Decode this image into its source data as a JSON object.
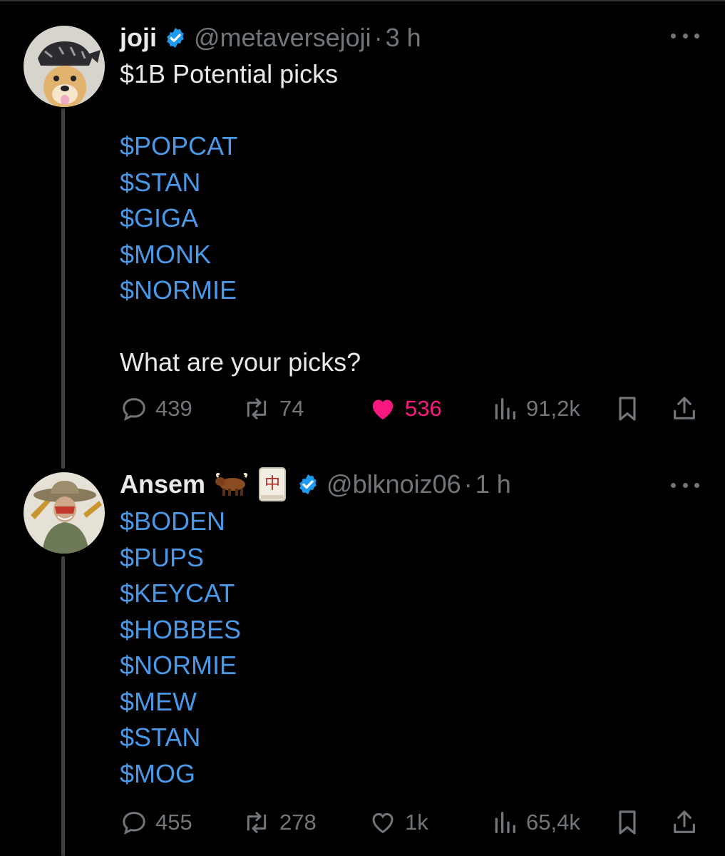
{
  "tweets": [
    {
      "name": "joji",
      "handle": "@metaversejoji",
      "time_separator": "·",
      "time": "3 h",
      "lines": [
        "$1B Potential picks",
        "",
        "$POPCAT",
        "$STAN",
        "$GIGA",
        "$MONK",
        "$NORMIE",
        "",
        "What are your picks?"
      ],
      "cashtag_lines": [
        false,
        false,
        true,
        true,
        true,
        true,
        true,
        false,
        false
      ],
      "stats": {
        "replies": "439",
        "reposts": "74",
        "likes": "536",
        "views": "91,2k"
      },
      "liked": true,
      "avatar_icon": "shiba-dog-bandana-avatar"
    },
    {
      "name": "Ansem",
      "name_emojis": [
        "ox-emoji",
        "mahjong-red-dragon-emoji"
      ],
      "handle": "@blknoiz06",
      "time_separator": "·",
      "time": "1 h",
      "lines": [
        "$BODEN",
        "$PUPS",
        "$KEYCAT",
        "$HOBBES",
        "$NORMIE",
        "$MEW",
        "$STAN",
        "$MOG"
      ],
      "cashtag_lines": [
        true,
        true,
        true,
        true,
        true,
        true,
        true,
        true
      ],
      "stats": {
        "replies": "455",
        "reposts": "278",
        "likes": "1k",
        "views": "65,4k"
      },
      "liked": false,
      "avatar_icon": "cowboy-character-avatar"
    }
  ],
  "mahjong_glyph": "中",
  "colors": {
    "background": "#000000",
    "link": "#4a99e9",
    "muted": "#71767b",
    "like": "#f91880",
    "verified": "#1d9bf0",
    "thread_line": "#3e4144"
  }
}
